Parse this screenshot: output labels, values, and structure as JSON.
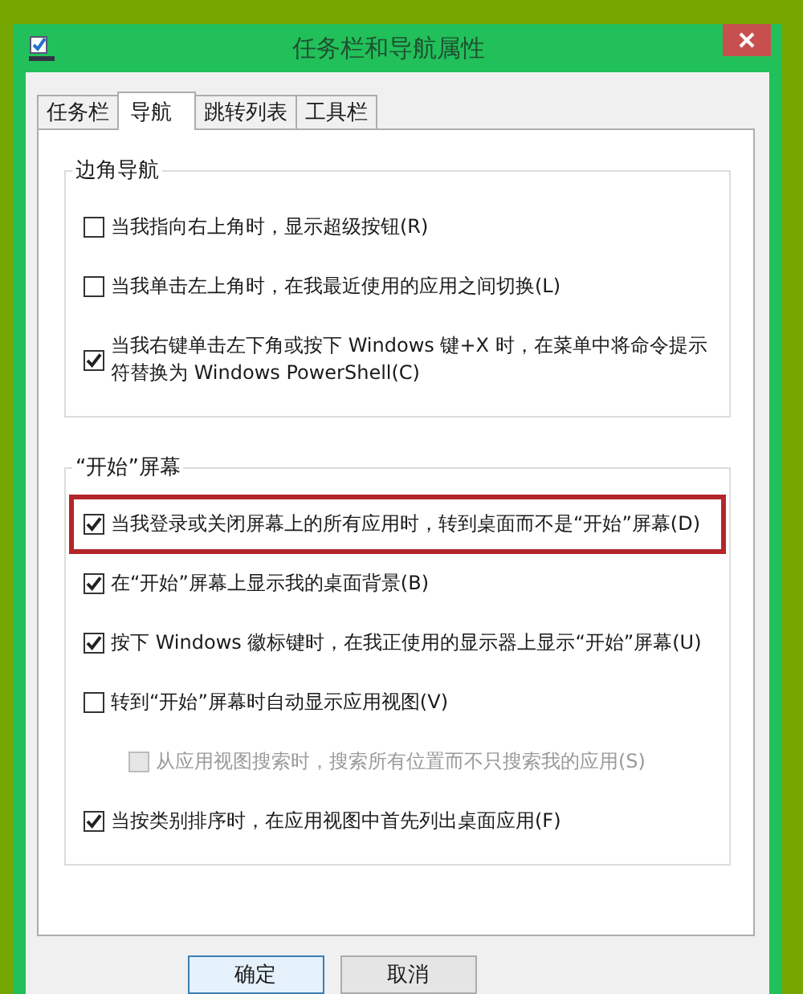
{
  "window": {
    "title": "任务栏和导航属性"
  },
  "tabs": [
    {
      "label": "任务栏",
      "selected": false
    },
    {
      "label": "导航",
      "selected": true
    },
    {
      "label": "跳转列表",
      "selected": false
    },
    {
      "label": "工具栏",
      "selected": false
    }
  ],
  "groups": [
    {
      "title": "边角导航",
      "items": [
        {
          "label": "当我指向右上角时，显示超级按钮(R)",
          "checked": false,
          "disabled": false,
          "highlighted": false
        },
        {
          "label": "当我单击左上角时，在我最近使用的应用之间切换(L)",
          "checked": false,
          "disabled": false,
          "highlighted": false
        },
        {
          "label": "当我右键单击左下角或按下 Windows 键+X 时，在菜单中将命令提示符替换为 Windows PowerShell(C)",
          "checked": true,
          "disabled": false,
          "highlighted": false
        }
      ]
    },
    {
      "title": "“开始”屏幕",
      "items": [
        {
          "label": "当我登录或关闭屏幕上的所有应用时，转到桌面而不是“开始”屏幕(D)",
          "checked": true,
          "disabled": false,
          "highlighted": true
        },
        {
          "label": "在“开始”屏幕上显示我的桌面背景(B)",
          "checked": true,
          "disabled": false,
          "highlighted": false
        },
        {
          "label": "按下 Windows 徽标键时，在我正使用的显示器上显示“开始”屏幕(U)",
          "checked": true,
          "disabled": false,
          "highlighted": false
        },
        {
          "label": "转到“开始”屏幕时自动显示应用视图(V)",
          "checked": false,
          "disabled": false,
          "highlighted": false,
          "children": [
            {
              "label": "从应用视图搜索时，搜索所有位置而不只搜索我的应用(S)",
              "checked": false,
              "disabled": true,
              "highlighted": false
            }
          ]
        },
        {
          "label": "当按类别排序时，在应用视图中首先列出桌面应用(F)",
          "checked": true,
          "disabled": false,
          "highlighted": false
        }
      ]
    }
  ],
  "buttons": [
    {
      "label": "确定",
      "selected": true
    },
    {
      "label": "取消",
      "selected": false
    }
  ]
}
